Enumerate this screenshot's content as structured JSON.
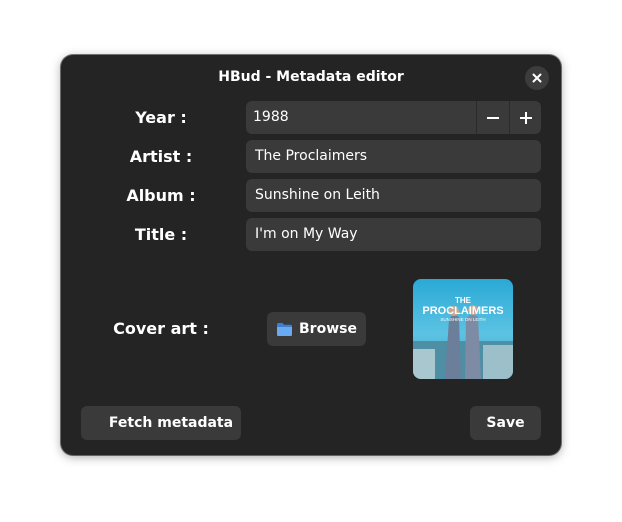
{
  "window": {
    "title": "HBud - Metadata editor"
  },
  "labels": {
    "year": "Year :",
    "artist": "Artist :",
    "album": "Album :",
    "title": "Title :",
    "cover_art": "Cover art :"
  },
  "fields": {
    "year": "1988",
    "artist": "The Proclaimers",
    "album": "Sunshine on Leith",
    "title": "I'm on My Way"
  },
  "buttons": {
    "browse": "Browse",
    "fetch_metadata": "Fetch metadata",
    "save": "Save"
  },
  "cover": {
    "band_line1": "THE",
    "band_line2": "PROCLAIMERS",
    "album_line": "SUNSHINE ON LEITH"
  },
  "icons": {
    "close": "close-icon",
    "minus": "minus-icon",
    "plus": "plus-icon",
    "folder": "folder-icon"
  },
  "colors": {
    "window_bg": "#242424",
    "control_bg": "#3a3a3a",
    "folder_blue": "#4a8fe0"
  }
}
